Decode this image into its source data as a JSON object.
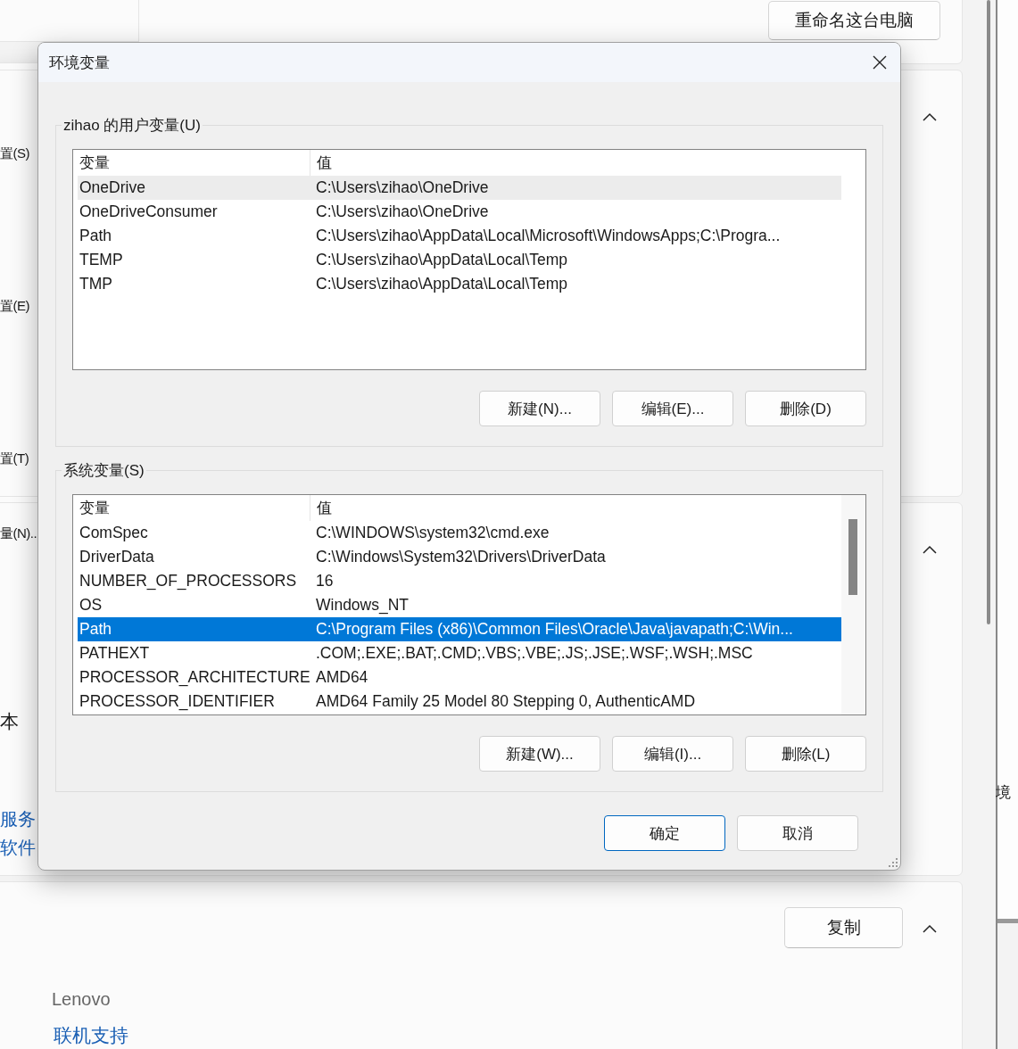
{
  "background": {
    "rename_button": "重命名这台电脑",
    "left_labels": [
      "置(S)",
      "置(E)",
      "置(T)",
      "量(N).."
    ],
    "left_text": "本",
    "left_links": [
      "服务",
      "软件"
    ],
    "copy_button": "复制",
    "brand": "Lenovo",
    "support_link": "联机支持",
    "right_window_text": "境"
  },
  "dialog": {
    "title": "环境变量",
    "groups": [
      {
        "legend": "zihao 的用户变量(U)",
        "columns": [
          "变量",
          "值"
        ],
        "focused": false,
        "scrollable": false,
        "rows": [
          {
            "name": "OneDrive",
            "value": "C:\\Users\\zihao\\OneDrive",
            "selected": true
          },
          {
            "name": "OneDriveConsumer",
            "value": "C:\\Users\\zihao\\OneDrive",
            "selected": false
          },
          {
            "name": "Path",
            "value": "C:\\Users\\zihao\\AppData\\Local\\Microsoft\\WindowsApps;C:\\Progra...",
            "selected": false
          },
          {
            "name": "TEMP",
            "value": "C:\\Users\\zihao\\AppData\\Local\\Temp",
            "selected": false
          },
          {
            "name": "TMP",
            "value": "C:\\Users\\zihao\\AppData\\Local\\Temp",
            "selected": false
          }
        ],
        "buttons": [
          "新建(N)...",
          "编辑(E)...",
          "删除(D)"
        ]
      },
      {
        "legend": "系统变量(S)",
        "columns": [
          "变量",
          "值"
        ],
        "focused": true,
        "scrollable": true,
        "rows": [
          {
            "name": "ComSpec",
            "value": "C:\\WINDOWS\\system32\\cmd.exe",
            "selected": false
          },
          {
            "name": "DriverData",
            "value": "C:\\Windows\\System32\\Drivers\\DriverData",
            "selected": false
          },
          {
            "name": "NUMBER_OF_PROCESSORS",
            "value": "16",
            "selected": false
          },
          {
            "name": "OS",
            "value": "Windows_NT",
            "selected": false
          },
          {
            "name": "Path",
            "value": "C:\\Program Files (x86)\\Common Files\\Oracle\\Java\\javapath;C:\\Win...",
            "selected": true
          },
          {
            "name": "PATHEXT",
            "value": ".COM;.EXE;.BAT;.CMD;.VBS;.VBE;.JS;.JSE;.WSF;.WSH;.MSC",
            "selected": false
          },
          {
            "name": "PROCESSOR_ARCHITECTURE",
            "value": "AMD64",
            "selected": false
          },
          {
            "name": "PROCESSOR_IDENTIFIER",
            "value": "AMD64 Family 25 Model 80 Stepping 0, AuthenticAMD",
            "selected": false
          }
        ],
        "buttons": [
          "新建(W)...",
          "编辑(I)...",
          "删除(L)"
        ]
      }
    ],
    "buttons": [
      {
        "label": "确定",
        "default": true
      },
      {
        "label": "取消",
        "default": false
      }
    ]
  }
}
